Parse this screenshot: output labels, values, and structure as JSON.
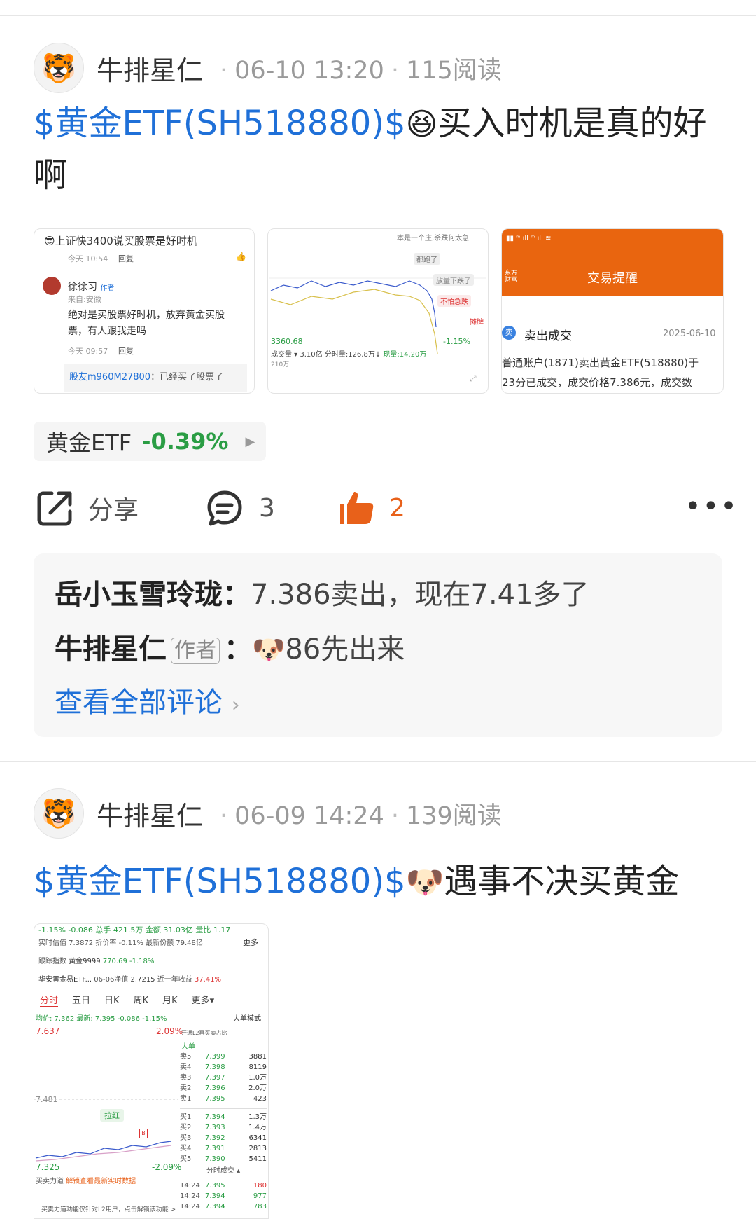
{
  "post1": {
    "author": "牛排星仁",
    "time": "06-10 13:20",
    "reads": "115阅读",
    "title_tag": "$黄金ETF(SH518880)$",
    "title_emoji": "😆",
    "title_text": "买入时机是真的好啊",
    "thumb1": {
      "top_text": "上证快3400说买股票是好时机",
      "time1": "今天 10:54",
      "reply1": "回复",
      "user": "徐徐习",
      "user_badge": "作者",
      "from": "来自:安徽",
      "body": "绝对是买股票好时机，放弃黄金买股票，有人跟我走吗",
      "time2": "今天 09:57",
      "reply2": "回复",
      "friend": "股友m960M27800",
      "friend_text": "：已经买了股票了"
    },
    "thumb2": {
      "note1": "本是一个庄,杀跌何太急",
      "note2": "都跑了",
      "note3": "放量下跌了",
      "note4": "不怕急跌",
      "note5": "摊牌",
      "low": "3360.68",
      "pct": "-1.15%",
      "vol": "成交量 ▾ 3.10亿",
      "vol2": "分时量:126.8万↓",
      "vol3": "现量:14.20万",
      "vol4": "210万"
    },
    "thumb3": {
      "header": "交易提醒",
      "brand": "东方财富",
      "badge": "卖",
      "label": "卖出成交",
      "date": "2025-06-10",
      "line1": "普通账户(1871)卖出黄金ETF(518880)于",
      "line2": "23分已成交，成交价格7.386元，成交数"
    },
    "stock": {
      "name": "黄金ETF",
      "change": "-0.39%"
    },
    "share_label": "分享",
    "comments_count": "3",
    "likes_count": "2",
    "comments": [
      {
        "user": "岳小玉雪玲珑",
        "text": "7.386卖出，现在7.41多了"
      },
      {
        "user": "牛排星仁",
        "badge": "作者",
        "emoji": "🐶",
        "text": "86先出来"
      }
    ],
    "view_all": "查看全部评论"
  },
  "post2": {
    "author": "牛排星仁",
    "time": "06-09 14:24",
    "reads": "139阅读",
    "title_tag": "$黄金ETF(SH518880)$",
    "title_emoji": "🐶",
    "title_text": "遇事不决买黄金",
    "thumb": {
      "r0": "-1.15%  -0.086  总手 421.5万  金额 31.03亿  量比 1.17",
      "r1": "实时估值 7.3872  折价率 -0.11%  最新份额 79.48亿",
      "more": "更多",
      "r2a": "跟踪指数",
      "r2b": "黄金9999",
      "r2c": "770.69",
      "r2d": "-1.18%",
      "r3a": "华安黄金易ETF...",
      "r3b": "06-06净值",
      "r3c": "2.7215",
      "r3d": "近一年收益",
      "r3e": "37.41%",
      "tabs": [
        "分时",
        "五日",
        "日K",
        "周K",
        "月K",
        "更多▾"
      ],
      "legend": "均价: 7.362  最新: 7.395  -0.086  -1.15%",
      "mode": "大单模式",
      "high": "7.637",
      "high_pct": "2.09%",
      "mid": "7.481",
      "low": "7.325",
      "low_pct": "-2.09%",
      "tag_lahong": "拉红",
      "l2": "开通L2再买卖占比",
      "big": "大单",
      "asks": [
        [
          "卖5",
          "7.399",
          "3881"
        ],
        [
          "卖4",
          "7.398",
          "8119"
        ],
        [
          "卖3",
          "7.397",
          "1.0万"
        ],
        [
          "卖2",
          "7.396",
          "2.0万"
        ],
        [
          "卖1",
          "7.395",
          "423"
        ]
      ],
      "bids": [
        [
          "买1",
          "7.394",
          "1.3万"
        ],
        [
          "买2",
          "7.393",
          "1.4万"
        ],
        [
          "买3",
          "7.392",
          "6341"
        ],
        [
          "买4",
          "7.391",
          "2813"
        ],
        [
          "买5",
          "7.390",
          "5411"
        ]
      ],
      "trades_title": "分时成交 ▴",
      "trades": [
        [
          "14:24",
          "7.395",
          "180"
        ],
        [
          "14:24",
          "7.394",
          "977"
        ],
        [
          "14:24",
          "7.394",
          "783"
        ]
      ],
      "buy_power": "买卖力道",
      "unlock": "解锁查看最新实时数据",
      "bottom": "买卖力道功能仅针对L2用户，点击解锁该功能 >"
    }
  }
}
